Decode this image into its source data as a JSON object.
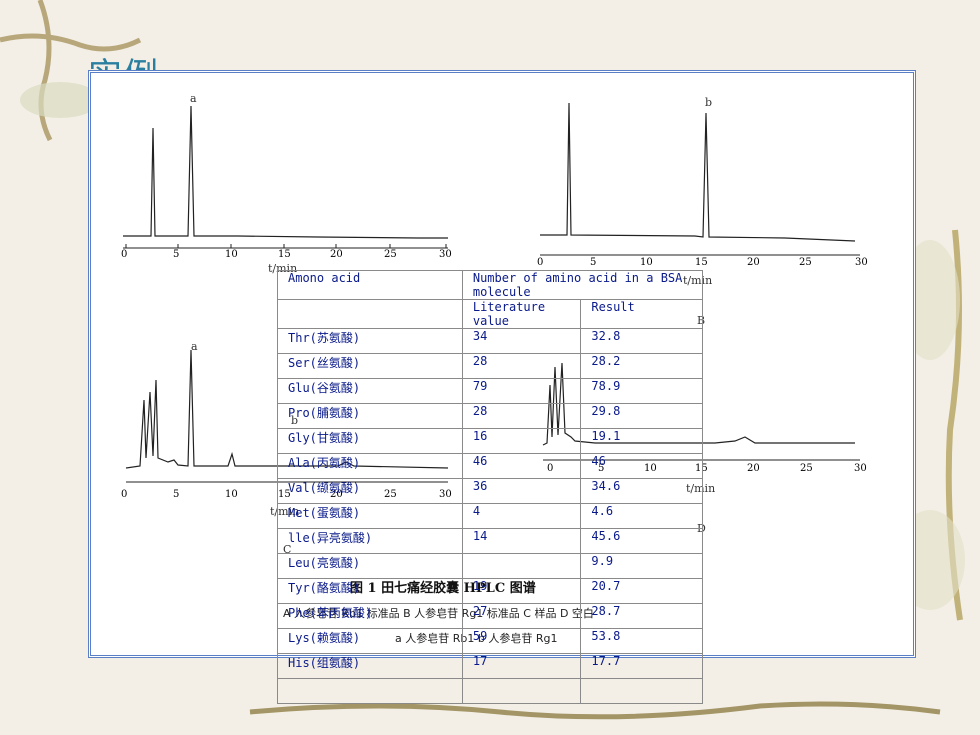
{
  "slide_title": "实例",
  "chromatograms": {
    "a": {
      "peak_label": "a",
      "panel": "A",
      "axis_unit": "t/min",
      "ticks": [
        "0",
        "5",
        "10",
        "15",
        "20",
        "25",
        "30"
      ]
    },
    "b": {
      "peak_label": "b",
      "panel": "B",
      "axis_unit": "t/min",
      "ticks": [
        "0",
        "5",
        "10",
        "15",
        "20",
        "25",
        "30"
      ]
    },
    "c": {
      "peak_label_a": "a",
      "peak_label_b": "b",
      "panel": "C",
      "axis_unit": "t/min",
      "ticks": [
        "0",
        "5",
        "10",
        "15",
        "20",
        "25",
        "30"
      ]
    },
    "d": {
      "panel": "D",
      "axis_unit": "t/min",
      "ticks": [
        "0",
        "5",
        "10",
        "15",
        "20",
        "25",
        "30"
      ]
    }
  },
  "figure_caption": "图 1  田七痛经胶囊 HPLC 图谱",
  "figure_legend": "A 人参皂苷 Rb1 标准品  B 人参皂苷 Rg1 标准品  C 样品  D 空白",
  "figure_legend_2": "a 人参皂苷 Rb1  b 人参皂苷 Rg1",
  "table": {
    "col1_header": "Amono acid",
    "col23_header": "Number of amino acid in a BSA molecule",
    "col2_sub": "Literature value",
    "col3_sub": "Result",
    "rows": [
      [
        "Thr(苏氨酸)",
        "34",
        "32.8"
      ],
      [
        "Ser(丝氨酸)",
        "28",
        "28.2"
      ],
      [
        "Glu(谷氨酸)",
        "79",
        "78.9"
      ],
      [
        "Pro(脯氨酸)",
        "28",
        "29.8"
      ],
      [
        "Gly(甘氨酸)",
        "16",
        "19.1"
      ],
      [
        "Ala(丙氨酸)",
        "46",
        "46"
      ],
      [
        "Val(缬氨酸)",
        "36",
        "34.6"
      ],
      [
        "Met(蛋氨酸)",
        "4",
        "4.6"
      ],
      [
        "lle(异亮氨酸)",
        "14",
        "45.6"
      ],
      [
        "Leu(亮氨酸)",
        "",
        "9.9"
      ],
      [
        "Tyr(酪氨酸)",
        "19",
        "20.7"
      ],
      [
        "Phe(苯丙氨酸)",
        "27",
        "28.7"
      ],
      [
        "Lys(赖氨酸)",
        "59",
        "53.8"
      ],
      [
        "His(组氨酸)",
        "17",
        "17.7"
      ],
      [
        "",
        "",
        ""
      ]
    ]
  }
}
